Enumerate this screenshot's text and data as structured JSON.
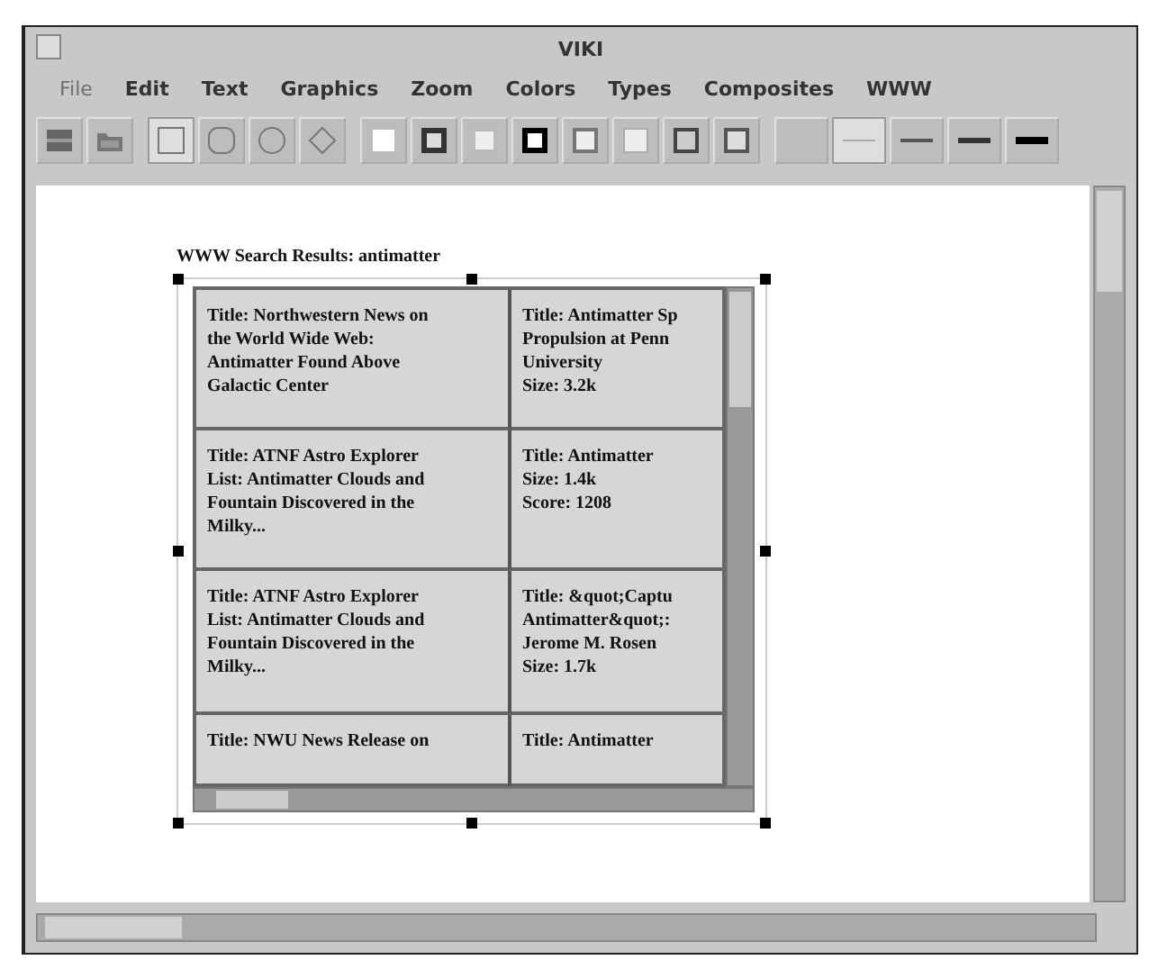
{
  "window": {
    "title": "VIKI"
  },
  "menu": [
    {
      "label": "File",
      "disabled": true
    },
    {
      "label": "Edit",
      "disabled": false
    },
    {
      "label": "Text",
      "disabled": false
    },
    {
      "label": "Graphics",
      "disabled": false
    },
    {
      "label": "Zoom",
      "disabled": false
    },
    {
      "label": "Colors",
      "disabled": false
    },
    {
      "label": "Types",
      "disabled": false
    },
    {
      "label": "Composites",
      "disabled": false
    },
    {
      "label": "WWW",
      "disabled": false
    }
  ],
  "toolbar": {
    "shapes": [
      {
        "kind": "square",
        "selected": true
      },
      {
        "kind": "rounded",
        "selected": false
      },
      {
        "kind": "circle",
        "selected": false
      },
      {
        "kind": "diamond",
        "selected": false
      }
    ],
    "lines": [
      {
        "kind": "none",
        "selected": false
      },
      {
        "kind": "hairline",
        "selected": true
      },
      {
        "kind": "thin",
        "selected": false
      },
      {
        "kind": "medium",
        "selected": false
      },
      {
        "kind": "thick",
        "selected": false
      }
    ]
  },
  "search_results": {
    "heading": "WWW Search Results: antimatter",
    "rows": [
      {
        "cells": [
          [
            "Title: Northwestern News on",
            "the World Wide Web:",
            "Antimatter Found Above",
            "Galactic Center"
          ],
          [
            "Title: Antimatter Sp",
            "Propulsion at Penn",
            "University",
            "Size: 3.2k"
          ]
        ]
      },
      {
        "cells": [
          [
            "Title: ATNF Astro Explorer",
            "List: Antimatter Clouds and",
            "Fountain Discovered in the",
            "Milky..."
          ],
          [
            "Title: Antimatter",
            "Size: 1.4k",
            "Score: 1208"
          ]
        ]
      },
      {
        "cells": [
          [
            "Title: ATNF Astro Explorer",
            "List: Antimatter Clouds and",
            "Fountain Discovered in the",
            "Milky..."
          ],
          [
            "Title: &quot;Captu",
            "Antimatter&quot;:",
            "Jerome M. Rosen",
            "Size: 1.7k"
          ]
        ]
      },
      {
        "cells": [
          [
            "Title: NWU News Release on"
          ],
          [
            "Title: Antimatter"
          ]
        ]
      }
    ]
  }
}
